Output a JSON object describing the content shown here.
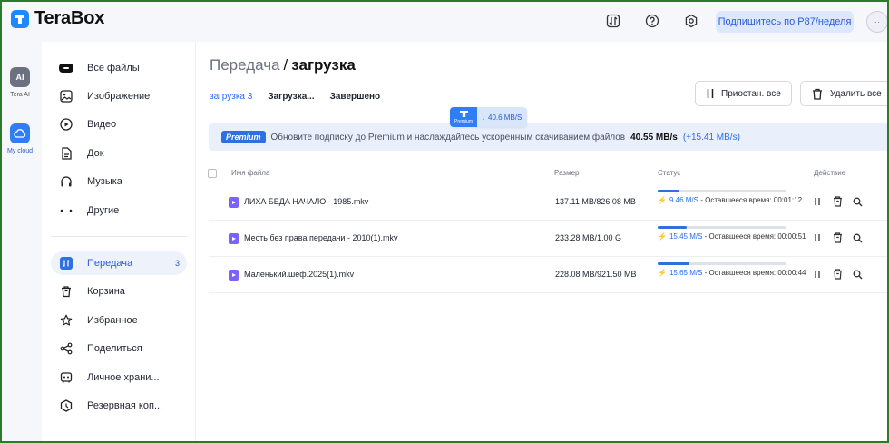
{
  "app": {
    "name": "TeraBox"
  },
  "topbar": {
    "subscribe_label": "Подпишитесь по P87/неделя",
    "icons": [
      "transfer-icon",
      "help-icon",
      "settings-icon"
    ],
    "avatar_text": "··"
  },
  "rail": {
    "items": [
      {
        "icon": "ai-icon",
        "label": "Tera AI",
        "badge": "AI"
      },
      {
        "icon": "cloud-icon",
        "label": "My cloud"
      }
    ]
  },
  "sidebar": {
    "files": [
      {
        "label": "Все файлы",
        "icon": "all-files-icon"
      },
      {
        "label": "Изображение",
        "icon": "image-icon"
      },
      {
        "label": "Видео",
        "icon": "video-icon"
      },
      {
        "label": "Док",
        "icon": "document-icon"
      },
      {
        "label": "Музыка",
        "icon": "music-icon"
      },
      {
        "label": "Другие",
        "icon": "more-icon"
      }
    ],
    "tools": [
      {
        "label": "Передача",
        "icon": "transfer-icon",
        "count": "3",
        "active": true
      },
      {
        "label": "Корзина",
        "icon": "trash-icon"
      },
      {
        "label": "Избранное",
        "icon": "star-icon"
      },
      {
        "label": "Поделиться",
        "icon": "share-icon"
      },
      {
        "label": "Личное храни...",
        "icon": "private-vault-icon"
      },
      {
        "label": "Резервная коп...",
        "icon": "backup-icon"
      }
    ]
  },
  "main": {
    "breadcrumb": {
      "prev": "Передача",
      "sep": "/",
      "current": "загрузка"
    },
    "tabs": [
      {
        "label": "загрузка 3",
        "active": true
      },
      {
        "label": "Загрузка...",
        "active": false
      },
      {
        "label": "Завершено",
        "active": false
      }
    ],
    "pause_all_label": "Приостан. все",
    "delete_all_label": "Удалить все",
    "speed_chip": {
      "brand": "Premium",
      "speed": "40.6 MB/S"
    },
    "promo": {
      "badge": "Premium",
      "text": "Обновите подписку до Premium и наслаждайтесь ускоренным скачиванием файлов",
      "speed": "40.55 MB/s",
      "extra": "(+15.41 MB/s)"
    },
    "table": {
      "columns": {
        "name": "Имя файла",
        "size": "Размер",
        "status": "Статус",
        "action": "Действие"
      },
      "rows": [
        {
          "name": "ЛИХА БЕДА НАЧАЛО - 1985.mkv",
          "size": "137.11 MB/826.08 MB",
          "speed": "9.46 M/S",
          "remaining": " - Оставшееся время: 00:01:12",
          "progress": 0.166
        },
        {
          "name": "Месть без права передачи - 2010(1).mkv",
          "size": "233.28 MB/1.00 G",
          "speed": "15.45 M/S",
          "remaining": " - Оставшееся время: 00:00:51",
          "progress": 0.228
        },
        {
          "name": "Маленький.шеф.2025(1).mkv",
          "size": "228.08 MB/921.50 MB",
          "speed": "15.65 M/S",
          "remaining": " - Оставшееся время: 00:00:44",
          "progress": 0.248
        }
      ]
    }
  },
  "colors": {
    "accent": "#2a6bf0",
    "brand": "#1e88ff",
    "file_video": "#7b61ff",
    "frame": "#2c7a2c"
  }
}
